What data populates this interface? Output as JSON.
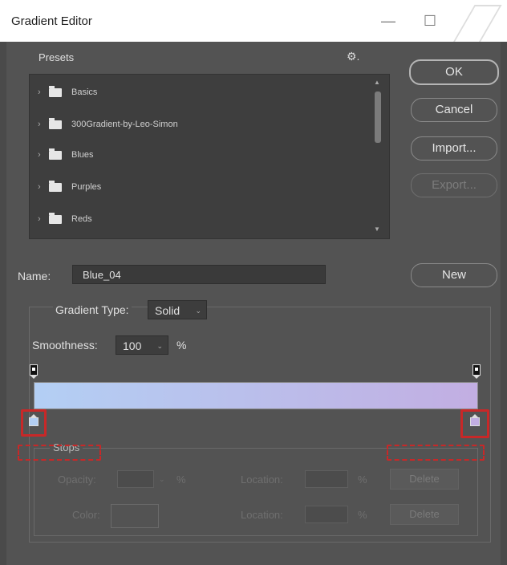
{
  "window": {
    "title": "Gradient Editor",
    "minimize_glyph": "—",
    "maximize_glyph": "☐",
    "close_glyph": "✕"
  },
  "presets": {
    "label": "Presets",
    "settings_icon": "gear-icon",
    "items": [
      {
        "label": "Basics"
      },
      {
        "label": "300Gradient-by-Leo-Simon"
      },
      {
        "label": "Blues"
      },
      {
        "label": "Purples"
      },
      {
        "label": "Reds"
      }
    ]
  },
  "buttons": {
    "ok": "OK",
    "cancel": "Cancel",
    "import": "Import...",
    "export": "Export...",
    "new": "New"
  },
  "name": {
    "label": "Name:",
    "value": "Blue_04"
  },
  "gradient": {
    "type_label": "Gradient Type:",
    "type_value": "Solid",
    "smoothness_label": "Smoothness:",
    "smoothness_value": "100",
    "smoothness_unit": "%",
    "start_color": "#b3cff4",
    "end_color": "#c2aee2",
    "highlight_color": "#c82828"
  },
  "stops": {
    "legend": "Stops",
    "opacity_label": "Opacity:",
    "opacity_unit": "%",
    "location_label": "Location:",
    "location_unit": "%",
    "color_label": "Color:",
    "delete_label": "Delete"
  }
}
